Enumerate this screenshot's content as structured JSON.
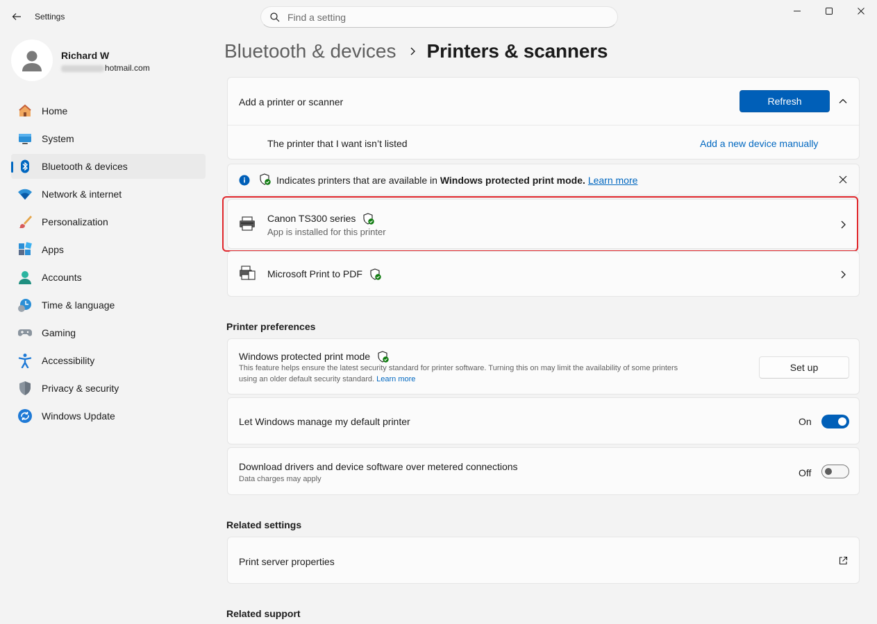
{
  "window": {
    "title": "Settings",
    "search_placeholder": "Find a setting"
  },
  "profile": {
    "name": "Richard W",
    "email_visible": "hotmail.com"
  },
  "nav": [
    {
      "label": "Home",
      "icon": "home-icon"
    },
    {
      "label": "System",
      "icon": "system-icon"
    },
    {
      "label": "Bluetooth & devices",
      "icon": "bluetooth-icon",
      "active": true
    },
    {
      "label": "Network & internet",
      "icon": "wifi-icon"
    },
    {
      "label": "Personalization",
      "icon": "paintbrush-icon"
    },
    {
      "label": "Apps",
      "icon": "apps-icon"
    },
    {
      "label": "Accounts",
      "icon": "accounts-icon"
    },
    {
      "label": "Time & language",
      "icon": "time-language-icon"
    },
    {
      "label": "Gaming",
      "icon": "gamepad-icon"
    },
    {
      "label": "Accessibility",
      "icon": "accessibility-icon"
    },
    {
      "label": "Privacy & security",
      "icon": "shield-icon"
    },
    {
      "label": "Windows Update",
      "icon": "update-icon"
    }
  ],
  "breadcrumb": {
    "parent": "Bluetooth & devices",
    "current": "Printers & scanners"
  },
  "add_printer": {
    "label": "Add a printer or scanner",
    "refresh_label": "Refresh",
    "not_listed_label": "The printer that I want isn’t listed",
    "add_manually_link": "Add a new device manually"
  },
  "info_bar": {
    "text_before": "Indicates printers that are available in ",
    "text_bold": "Windows protected print mode.",
    "learn_more": "Learn more"
  },
  "printers": [
    {
      "name": "Canon TS300 series",
      "subtitle": "App is installed for this printer",
      "highlighted": true
    },
    {
      "name": "Microsoft Print to PDF",
      "subtitle": ""
    }
  ],
  "printer_preferences": {
    "section_title": "Printer preferences",
    "protected_mode": {
      "title": "Windows protected print mode",
      "description_line1": "This feature helps ensure the latest security standard for printer software. Turning this on may limit the availability of some printers",
      "description_line2": "using an older default security standard.",
      "learn_more": "Learn more",
      "button_label": "Set up"
    },
    "default_printer": {
      "title": "Let Windows manage my default printer",
      "state_label": "On",
      "on": true
    },
    "metered": {
      "title": "Download drivers and device software over metered connections",
      "subtitle": "Data charges may apply",
      "state_label": "Off",
      "on": false
    }
  },
  "related_settings": {
    "section_title": "Related settings",
    "print_server": "Print server properties"
  },
  "related_support": {
    "section_title": "Related support"
  },
  "colors": {
    "accent": "#005fb8",
    "highlight_border": "#e0262b",
    "shield_green": "#0f7b0f"
  }
}
